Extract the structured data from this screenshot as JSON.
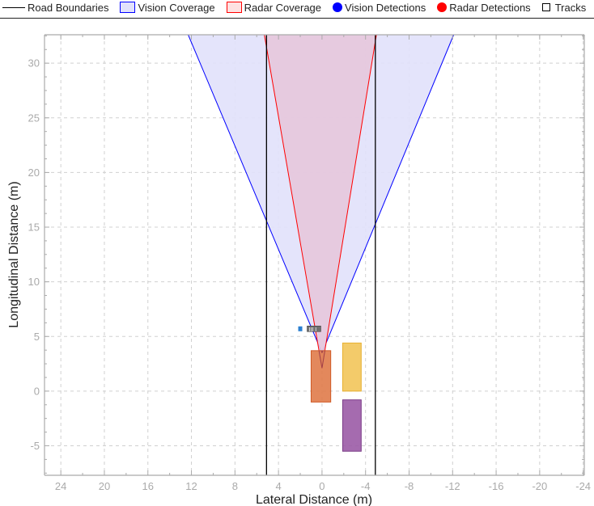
{
  "legend": {
    "items": [
      {
        "kind": "line",
        "label": "Road Boundaries",
        "color": "#000000"
      },
      {
        "kind": "box",
        "label": "Vision Coverage",
        "fill": "#e1e1fb",
        "stroke": "#0000ff"
      },
      {
        "kind": "box",
        "label": "Radar Coverage",
        "fill": "#fde1e1",
        "stroke": "#ff0000"
      },
      {
        "kind": "dot",
        "label": "Vision Detections",
        "color": "#0000ff"
      },
      {
        "kind": "dot",
        "label": "Radar Detections",
        "color": "#ff0000"
      },
      {
        "kind": "square",
        "label": "Tracks",
        "color": "#000000"
      }
    ]
  },
  "chart_data": {
    "type": "birds-eye-plot",
    "title": "",
    "xlabel": "Lateral Distance (m)",
    "ylabel": "Longitudinal Distance (m)",
    "x_reversed": true,
    "xlim": [
      25.5,
      -24.1
    ],
    "ylim": [
      -7.7,
      32.6
    ],
    "xticks": [
      24,
      20,
      16,
      12,
      8,
      4,
      0,
      -4,
      -8,
      -12,
      -16,
      -20,
      -24
    ],
    "yticks": [
      -5,
      0,
      5,
      10,
      15,
      20,
      25,
      30
    ],
    "grid": true,
    "legend_position": "top",
    "road_boundaries": [
      {
        "lateral": 5.1,
        "color": "#000000"
      },
      {
        "lateral": -4.9,
        "color": "#000000"
      }
    ],
    "vision_coverage": {
      "fill": "#e1e1fb",
      "stroke": "#0000ff",
      "polygon": [
        [
          0,
          3.5
        ],
        [
          12.3,
          32.6
        ],
        [
          -12.1,
          32.6
        ]
      ]
    },
    "radar_coverage": {
      "fill": "#e6c6dc",
      "stroke": "#ff0000",
      "polygon": [
        [
          0,
          2.1
        ],
        [
          5.3,
          32.6
        ],
        [
          -5.0,
          32.6
        ]
      ]
    },
    "vehicles": [
      {
        "name": "ego",
        "color": "#e07b4a",
        "stroke": "#d05a26",
        "lateral": [
          1.0,
          -0.8
        ],
        "longitudinal": [
          -1.0,
          3.7
        ]
      },
      {
        "name": "vehicle-yellow",
        "color": "#f2c55a",
        "stroke": "#e8b030",
        "lateral": [
          -1.9,
          -3.6
        ],
        "longitudinal": [
          0.0,
          4.4
        ]
      },
      {
        "name": "vehicle-purple",
        "color": "#9b5ba6",
        "stroke": "#7c3d88",
        "lateral": [
          -1.9,
          -3.6
        ],
        "longitudinal": [
          -5.5,
          -0.8
        ]
      }
    ],
    "tracks": [
      {
        "label": "III  I",
        "lateral": 1.0,
        "longitudinal": 5.7
      }
    ],
    "vision_detections": [
      {
        "lateral": 2.0,
        "longitudinal": 5.7,
        "color": "#2b7fd0"
      }
    ],
    "radar_detections": []
  }
}
